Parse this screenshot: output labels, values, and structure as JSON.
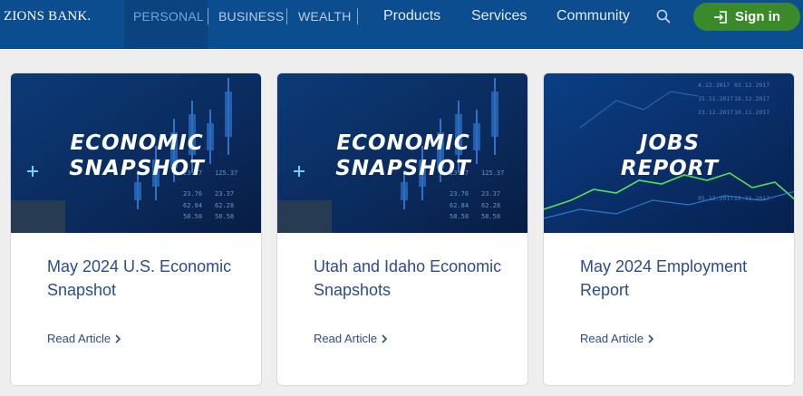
{
  "header": {
    "logo": "ZIONS BANK.",
    "segments": [
      {
        "label": "PERSONAL",
        "active": true
      },
      {
        "label": "BUSINESS",
        "active": false
      },
      {
        "label": "WEALTH",
        "active": false
      }
    ],
    "nav": [
      "Products",
      "Services",
      "Community"
    ],
    "search_icon": "search-icon",
    "signin_label": "Sign in",
    "signin_icon": "sign-in-icon",
    "colors": {
      "bar": "#0b4d8f",
      "signin": "#3a8a2a"
    }
  },
  "cards": [
    {
      "banner_line1": "ECONOMIC",
      "banner_line2": "SNAPSHOT",
      "title": "May 2024 U.S. Economic Snapshot",
      "link": "Read Article"
    },
    {
      "banner_line1": "ECONOMIC",
      "banner_line2": "SNAPSHOT",
      "title": "Utah and Idaho Economic Snapshots",
      "link": "Read Article"
    },
    {
      "banner_line1": "JOBS",
      "banner_line2": "REPORT",
      "title": "May 2024 Employment Report",
      "link": "Read Article"
    }
  ]
}
